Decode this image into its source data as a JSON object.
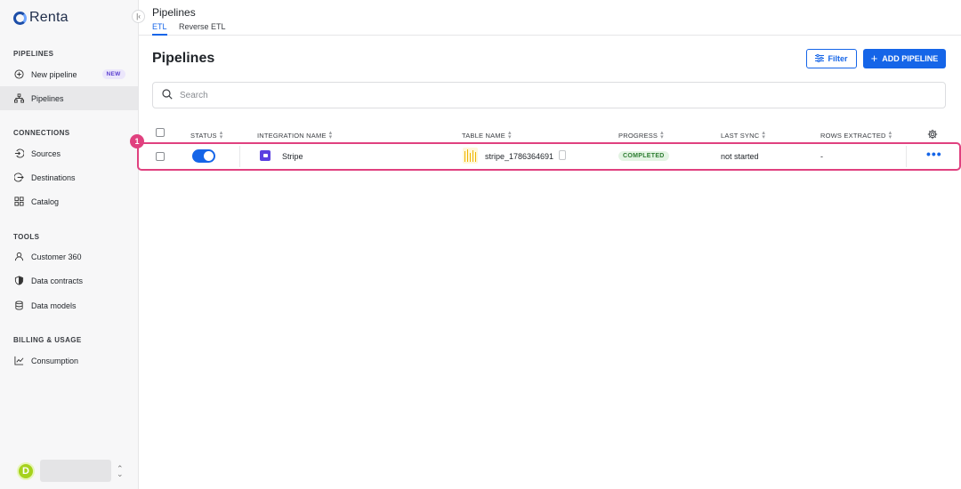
{
  "brand": {
    "name": "Renta"
  },
  "sidebar": {
    "sections": [
      {
        "label": "PIPELINES"
      },
      {
        "label": "CONNECTIONS"
      },
      {
        "label": "TOOLS"
      },
      {
        "label": "BILLING & USAGE"
      }
    ],
    "items": [
      {
        "label": "New pipeline",
        "icon": "plus-circle-icon",
        "badge": "NEW"
      },
      {
        "label": "Pipelines",
        "icon": "hierarchy-icon",
        "active": true
      },
      {
        "label": "Sources",
        "icon": "login-icon"
      },
      {
        "label": "Destinations",
        "icon": "logout-icon"
      },
      {
        "label": "Catalog",
        "icon": "grid-icon"
      },
      {
        "label": "Customer 360",
        "icon": "user-icon"
      },
      {
        "label": "Data contracts",
        "icon": "shield-icon"
      },
      {
        "label": "Data models",
        "icon": "database-icon"
      },
      {
        "label": "Consumption",
        "icon": "chart-line-icon"
      }
    ],
    "user": {
      "initial": "D"
    }
  },
  "header": {
    "title": "Pipelines",
    "tabs": [
      {
        "label": "ETL",
        "active": true
      },
      {
        "label": "Reverse ETL",
        "active": false
      }
    ]
  },
  "main": {
    "title": "Pipelines",
    "filter_label": "Filter",
    "add_label": "ADD PIPELINE",
    "search_placeholder": "Search",
    "columns": [
      "STATUS",
      "INTEGRATION NAME",
      "TABLE NAME",
      "PROGRESS",
      "LAST SYNC",
      "ROWS EXTRACTED"
    ],
    "rows": [
      {
        "enabled": true,
        "integration": "Stripe",
        "table": "stripe_1786364691",
        "progress": "COMPLETED",
        "last_sync": "not started",
        "rows_extracted": "-"
      }
    ],
    "marker": "1"
  },
  "colors": {
    "accent": "#1565e8",
    "highlight": "#e0417f",
    "success": "#2e7d32"
  }
}
